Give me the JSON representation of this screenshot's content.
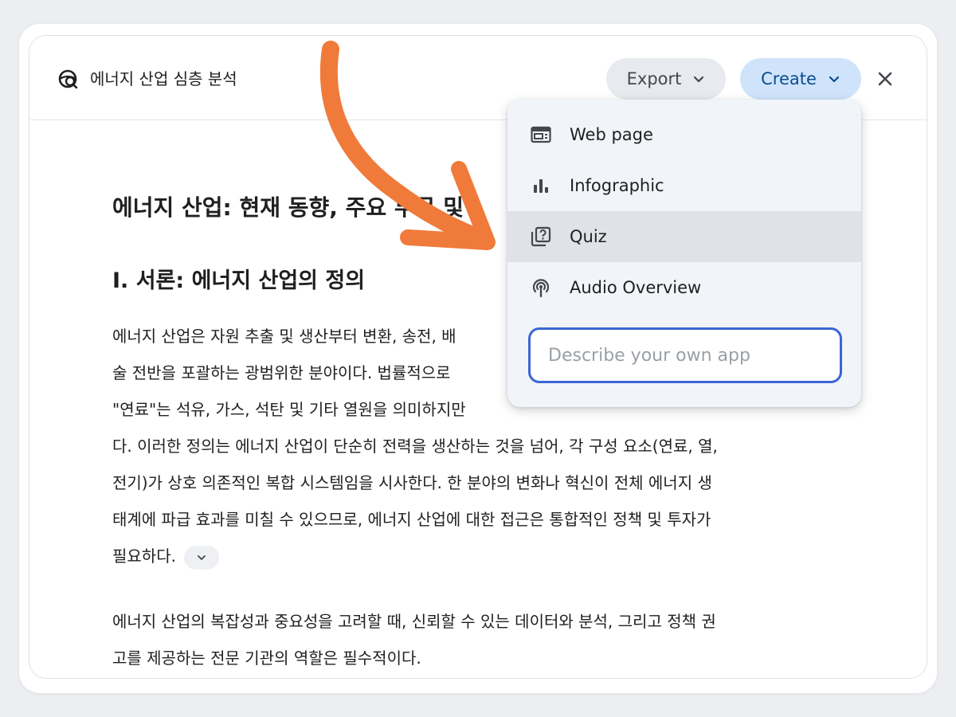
{
  "header": {
    "doc_title": "에너지 산업 심층 분석",
    "export_label": "Export",
    "create_label": "Create"
  },
  "document": {
    "heading1": "에너지 산업: 현재 동향, 주요 부문 및",
    "heading2": "I. 서론: 에너지 산업의 정의",
    "paragraph1_lines": [
      "에너지 산업은 자원 추출 및 생산부터 변환, 송전, 배",
      "술 전반을 포괄하는 광범위한 분야이다. 법률적으로",
      "\"연료\"는 석유, 가스, 석탄 및 기타 열원을 의미하지만",
      "다. 이러한 정의는 에너지 산업이 단순히 전력을 생산하는 것을 넘어, 각 구성 요소(연료, 열,",
      "전기)가 상호 의존적인 복합 시스템임을 시사한다. 한 분야의 변화나 혁신이 전체 에너지 생",
      "태계에 파급 효과를 미칠 수 있으므로, 에너지 산업에 대한 접근은 통합적인 정책 및 투자가",
      "필요하다."
    ],
    "paragraph2_lines": [
      "에너지 산업의 복잡성과 중요성을 고려할 때, 신뢰할 수 있는 데이터와 분석, 그리고 정책 권",
      "고를 제공하는 전문 기관의 역할은 필수적이다."
    ]
  },
  "create_menu": {
    "items": [
      {
        "label": "Web page",
        "icon": "web-page-icon"
      },
      {
        "label": "Infographic",
        "icon": "bar-chart-icon"
      },
      {
        "label": "Quiz",
        "icon": "quiz-icon"
      },
      {
        "label": "Audio Overview",
        "icon": "podcast-icon"
      }
    ],
    "describe_placeholder": "Describe your own app"
  },
  "colors": {
    "create_bg": "#cfe4fb",
    "export_bg": "#e7eaef",
    "menu_bg": "#f1f4f9",
    "input_border": "#3a66d4",
    "arrow": "#f07a3a"
  }
}
